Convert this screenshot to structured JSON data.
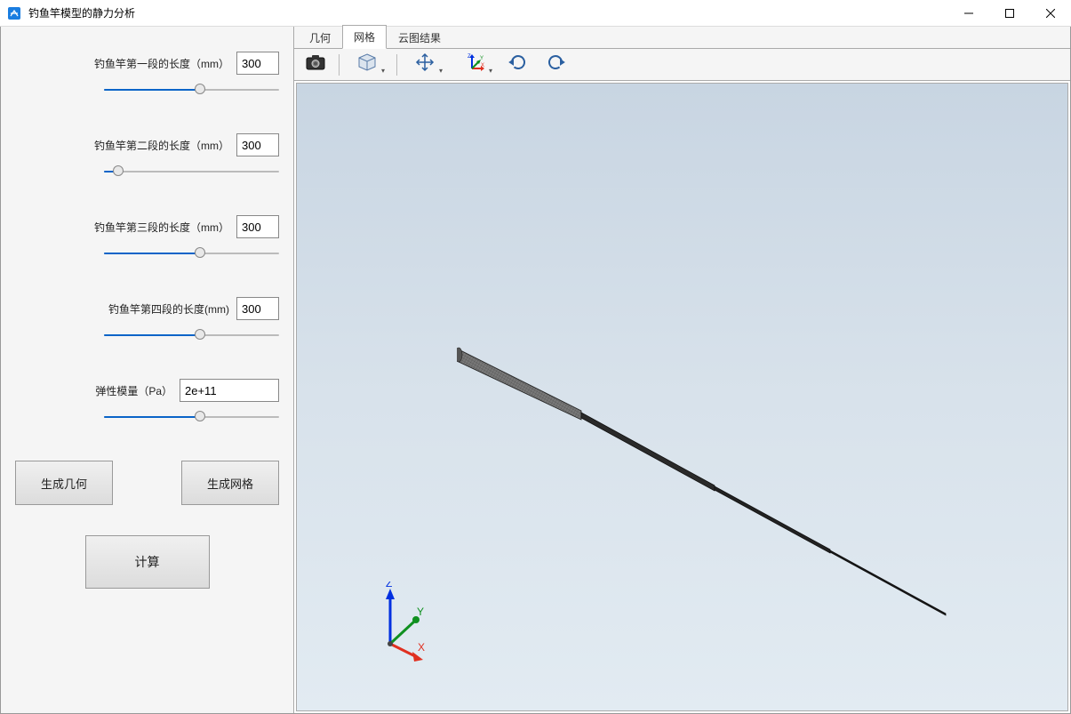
{
  "window": {
    "title": "钓鱼竿模型的静力分析"
  },
  "params": {
    "seg1": {
      "label": "钓鱼竿第一段的长度（mm）",
      "value": "300",
      "slider_pct": 55
    },
    "seg2": {
      "label": "钓鱼竿第二段的长度（mm）",
      "value": "300",
      "slider_pct": 8
    },
    "seg3": {
      "label": "钓鱼竿第三段的长度（mm）",
      "value": "300",
      "slider_pct": 55
    },
    "seg4": {
      "label": "钓鱼竿第四段的长度(mm)",
      "value": "300",
      "slider_pct": 55
    },
    "modulus": {
      "label": "弹性模量（Pa）",
      "value": "2e+11",
      "slider_pct": 55
    }
  },
  "buttons": {
    "gen_geom": "生成几何",
    "gen_mesh": "生成网格",
    "compute": "计算"
  },
  "tabs": {
    "geom": "几何",
    "mesh": "网格",
    "result": "云图结果"
  },
  "toolbar_icons": {
    "camera": "camera-icon",
    "cube": "cube-view-icon",
    "pan": "pan-icon",
    "axes": "coord-axes-icon",
    "rotate_cw": "rotate-cw-icon",
    "rotate_ccw": "rotate-ccw-icon"
  },
  "triad": {
    "x": "X",
    "y": "Y",
    "z": "Z"
  }
}
